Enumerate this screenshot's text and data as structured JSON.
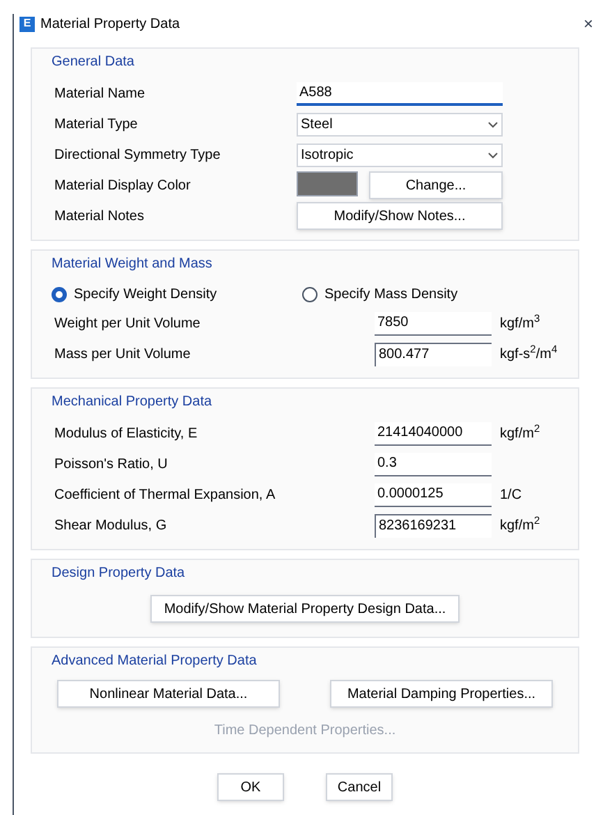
{
  "window": {
    "title": "Material Property Data",
    "app_icon": "E",
    "close": "×"
  },
  "general": {
    "title": "General Data",
    "rows": [
      {
        "kind": "text",
        "label": "Material Name",
        "value": "A588",
        "focused": true
      },
      {
        "kind": "select",
        "label": "Material Type",
        "value": "Steel"
      },
      {
        "kind": "select",
        "label": "Directional Symmetry Type",
        "value": "Isotropic"
      },
      {
        "kind": "color",
        "label": "Material Display Color",
        "color": "#6e6e6e",
        "button": "Change..."
      },
      {
        "kind": "button",
        "label": "Material Notes",
        "button": "Modify/Show Notes..."
      }
    ]
  },
  "weight": {
    "title": "Material Weight and Mass",
    "options": [
      {
        "label": "Specify Weight Density",
        "selected": true
      },
      {
        "label": "Specify Mass Density",
        "selected": false
      }
    ],
    "rows": [
      {
        "label": "Weight per Unit Volume",
        "value": "7850",
        "unit": "kgf/m$^{3}$",
        "readonly": false
      },
      {
        "label": "Mass per Unit Volume",
        "value": "800.477",
        "unit": "kgf-s$^{2}$/m$^{4}$",
        "readonly": true
      }
    ]
  },
  "mechanical": {
    "title": "Mechanical Property Data",
    "rows": [
      {
        "label": "Modulus of Elasticity,  E",
        "value": "21414040000",
        "unit": "kgf/m$^{2}$",
        "readonly": false
      },
      {
        "label": "Poisson's Ratio,  U",
        "value": "0.3",
        "unit": "",
        "readonly": false
      },
      {
        "label": "Coefficient of Thermal Expansion,  A",
        "value": "0.0000125",
        "unit": "1/C",
        "readonly": false
      },
      {
        "label": "Shear Modulus,  G",
        "value": "8236169231",
        "unit": "kgf/m$^{2}$",
        "readonly": true
      }
    ]
  },
  "design": {
    "title": "Design Property Data",
    "button": "Modify/Show Material Property Design Data..."
  },
  "advanced": {
    "title": "Advanced Material Property Data",
    "buttons": [
      {
        "label": "Nonlinear Material Data...",
        "disabled": false
      },
      {
        "label": "Material Damping Properties...",
        "disabled": false
      },
      {
        "label": "Time Dependent Properties...",
        "disabled": true
      }
    ]
  },
  "buttons": [
    "OK",
    "Cancel"
  ]
}
